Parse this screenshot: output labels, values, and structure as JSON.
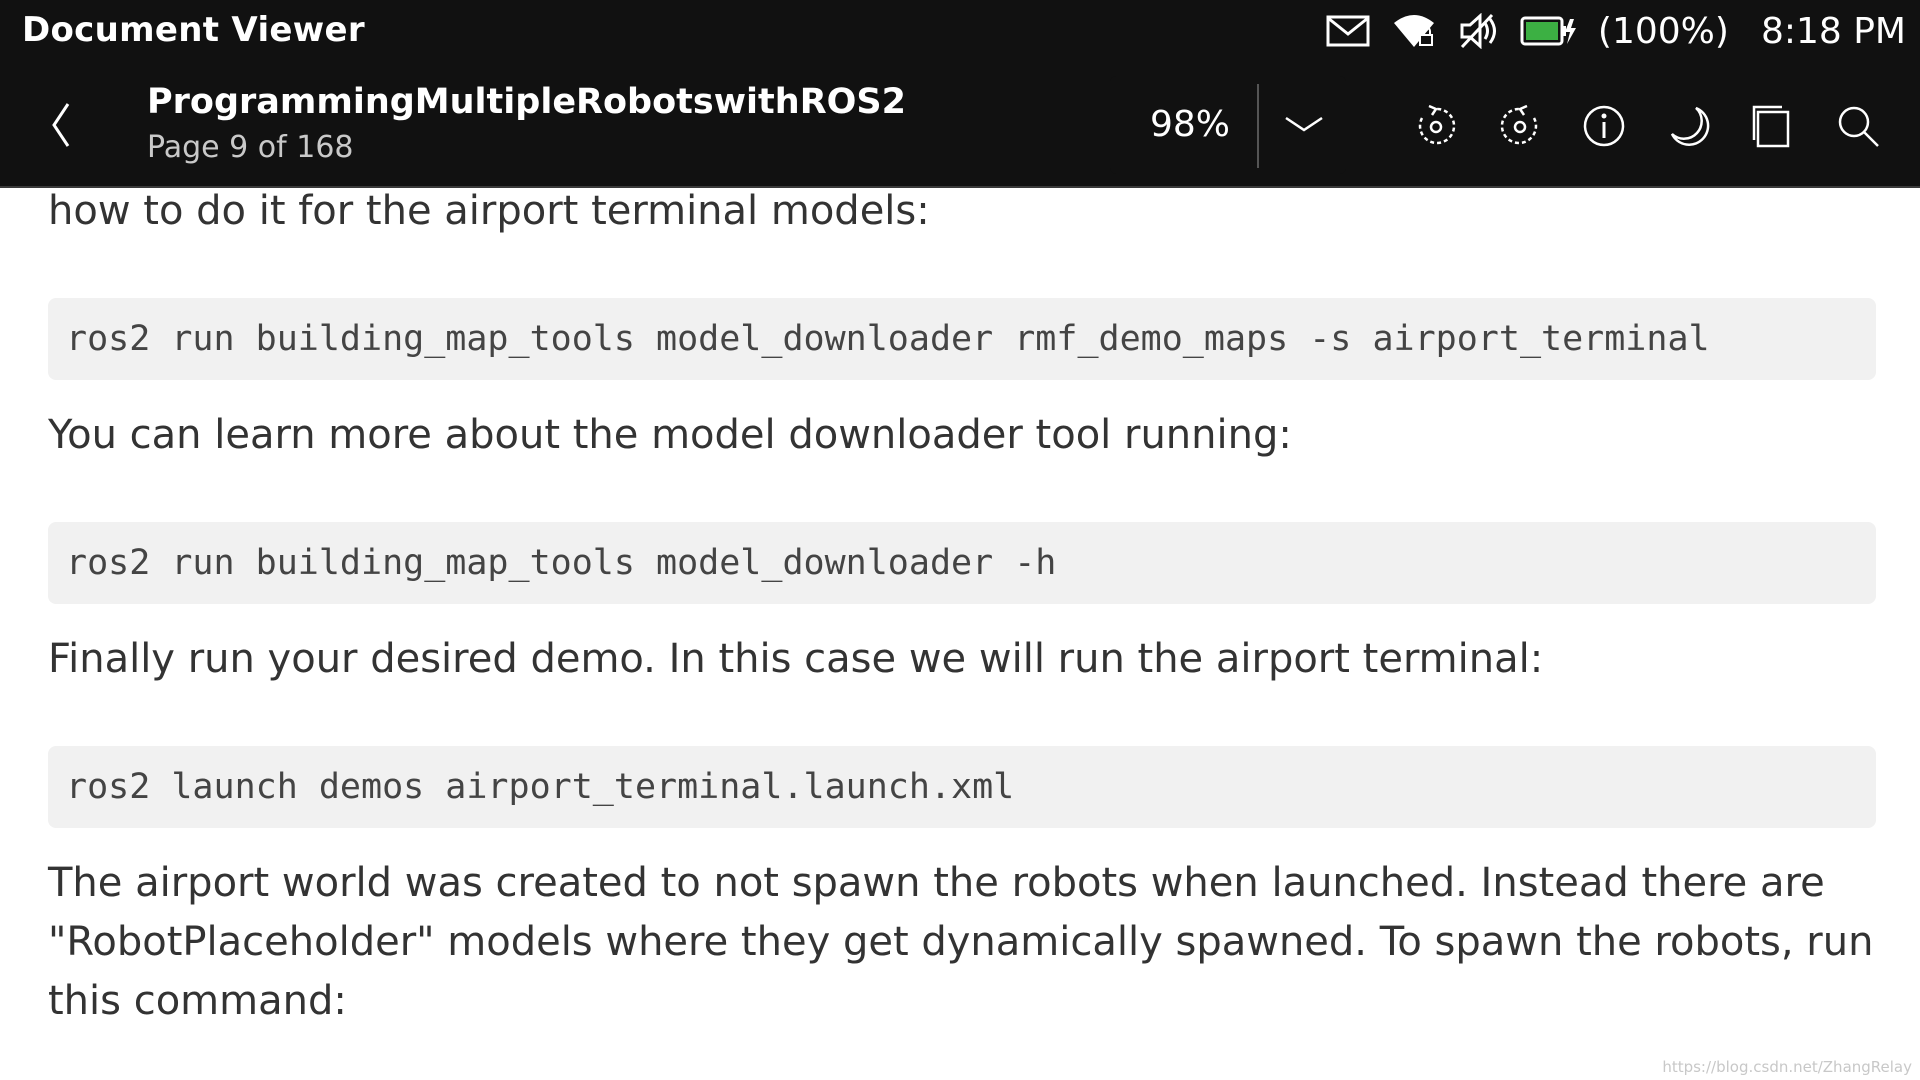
{
  "status_bar": {
    "app_title": "Document Viewer",
    "battery_text": "(100%)",
    "time": "8:18 PM",
    "icons": [
      "mail-icon",
      "wifi-icon",
      "volume-muted-icon",
      "battery-charging-icon"
    ],
    "battery_color": "#3cb043"
  },
  "header": {
    "title": "ProgrammingMultipleRobotswithROS2",
    "page_info": "Page 9 of 168",
    "zoom": "98%",
    "icons": [
      "back-icon",
      "zoom-dropdown-icon",
      "rotate-left-icon",
      "rotate-right-icon",
      "info-icon",
      "night-mode-icon",
      "pages-icon",
      "search-icon"
    ]
  },
  "content": {
    "p1": "how to do it for the airport terminal models:",
    "code1": "ros2 run building_map_tools model_downloader rmf_demo_maps -s airport_terminal",
    "p2": "You can learn more about the model downloader tool running:",
    "code2": "ros2 run building_map_tools model_downloader -h",
    "p3": "Finally run your desired demo. In this case we will run the airport terminal:",
    "code3": "ros2 launch demos airport_terminal.launch.xml",
    "p4": "The airport world was created to not spawn the robots when launched. Instead there are \"RobotPlaceholder\" models where they get dynamically spawned. To spawn the robots, run this command:"
  },
  "watermark": "https://blog.csdn.net/ZhangRelay"
}
